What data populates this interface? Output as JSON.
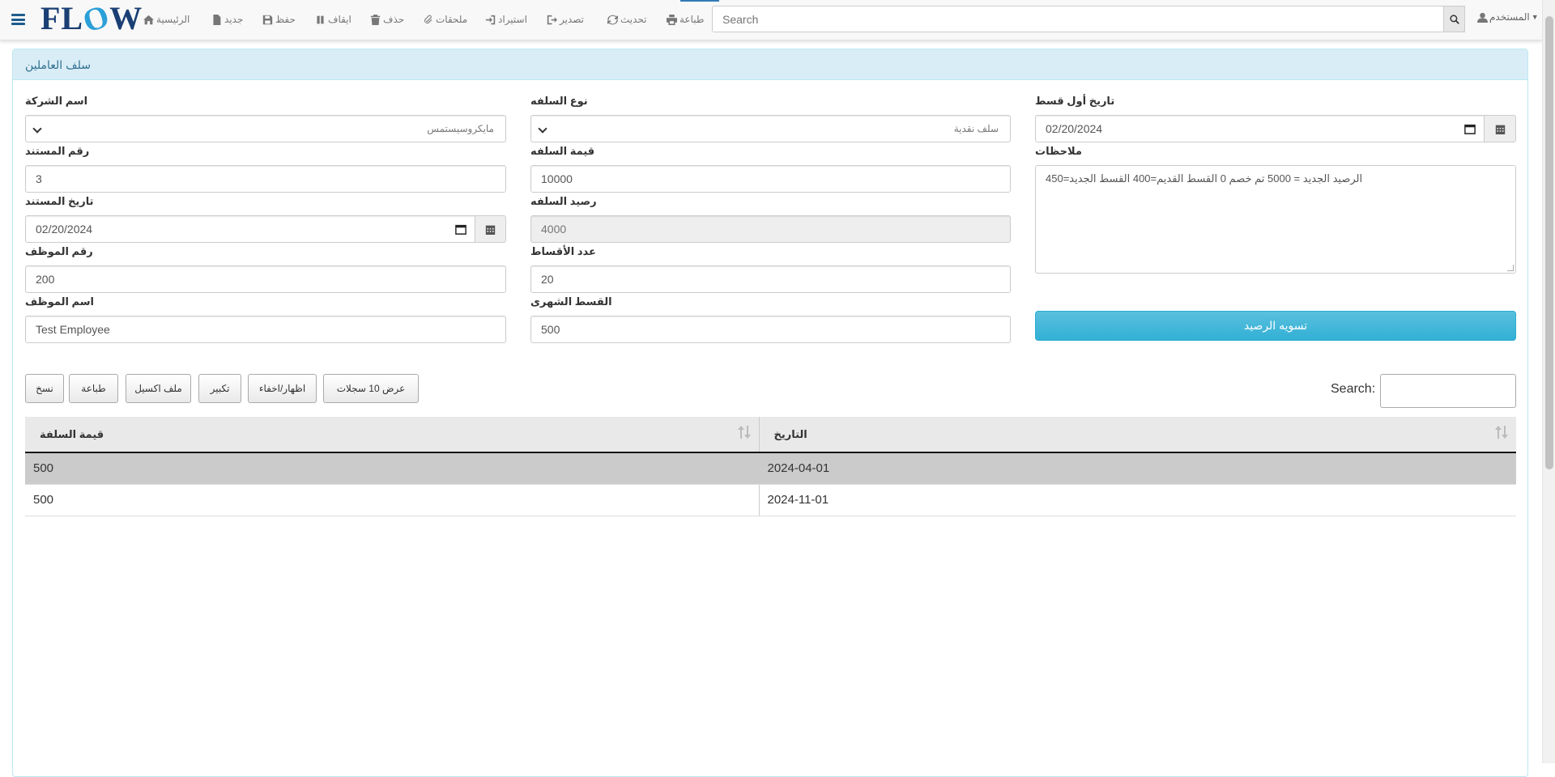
{
  "nav": {
    "logo": "FLOW",
    "items": {
      "home": "الرئيسية",
      "new": "جديد",
      "save": "حفظ",
      "stop": "ايقاف",
      "delete": "حذف",
      "attachments": "ملحقات",
      "import": "استيراد",
      "export": "تصدير",
      "refresh": "تحديث",
      "print": "طباعة"
    },
    "search_placeholder": "Search",
    "user": "المستخدم"
  },
  "panel": {
    "title": "سلف العاملين"
  },
  "form": {
    "company": {
      "label": "اسم الشركة",
      "value": "مايكروسيستمس"
    },
    "loan_type": {
      "label": "نوع السلفه",
      "value": "سلف نقدية"
    },
    "first_installment_date": {
      "label": "تاريخ أول قسط",
      "value": "02/20/2024"
    },
    "doc_number": {
      "label": "رقم المستند",
      "value": "3"
    },
    "loan_value": {
      "label": "قيمة السلفه",
      "value": "10000"
    },
    "notes": {
      "label": "ملاحظات",
      "value": "الرصيد الجديد = 5000 تم خصم 0 القسط القديم=400 القسط الجديد=450"
    },
    "doc_date": {
      "label": "تاريخ المستند",
      "value": "02/20/2024"
    },
    "loan_balance": {
      "label": "رصيد السلفه",
      "value": "4000"
    },
    "employee_number": {
      "label": "رقم الموظف",
      "value": "200"
    },
    "installments_count": {
      "label": "عدد الأقساط",
      "value": "20"
    },
    "employee_name": {
      "label": "اسم الموظف",
      "value": "Test Employee"
    },
    "monthly_installment": {
      "label": "القسط الشهرى",
      "value": "500"
    },
    "settle_button": "تسويه الرصيد"
  },
  "datatable": {
    "buttons": {
      "copy": "نسخ",
      "print": "طباعة",
      "excel": "ملف اكسيل",
      "expand": "تكبير",
      "toggle": "اظهار/اخفاء",
      "show10": "عرض 10 سجلات"
    },
    "search_label": "Search:",
    "columns": [
      "قيمة السلفة",
      "التاريخ"
    ],
    "rows": [
      [
        "500",
        "2024-04-01"
      ],
      [
        "500",
        "2024-11-01"
      ]
    ]
  }
}
